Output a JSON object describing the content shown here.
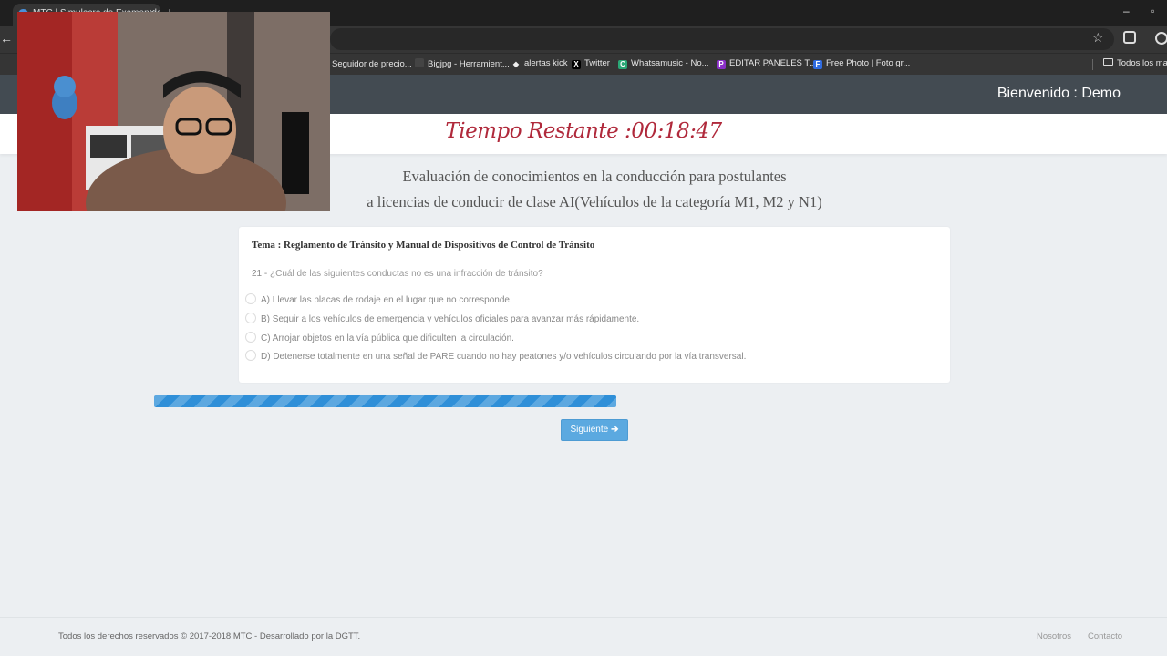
{
  "browser": {
    "tab_title": "MTC | Simulacro de Examen de...",
    "tab_close": "×",
    "new_tab": "+",
    "bookmarks": [
      {
        "label": "Seguidor de precio...",
        "icon": "price-tracker-icon",
        "color": "#2b2b2b",
        "glyph": ""
      },
      {
        "label": "Bigjpg - Herramient...",
        "icon": "bigjpg-icon",
        "color": "#444",
        "glyph": ""
      },
      {
        "label": "alertas kick",
        "icon": "kick-icon",
        "color": "#eee",
        "glyph": "◆"
      },
      {
        "label": "Twitter",
        "icon": "x-twitter-icon",
        "color": "#000",
        "glyph": "X"
      },
      {
        "label": "Whatsamusic - No...",
        "icon": "whatsamusic-icon",
        "color": "#2aa876",
        "glyph": "C"
      },
      {
        "label": "EDITAR PANELES T...",
        "icon": "editar-paneles-icon",
        "color": "#8b2fc9",
        "glyph": "P"
      },
      {
        "label": "Free Photo | Foto gr...",
        "icon": "freepik-icon",
        "color": "#2f6be0",
        "glyph": "F"
      }
    ],
    "all_bookmarks": "Todos los marc"
  },
  "header": {
    "welcome": "Bienvenido : Demo"
  },
  "timer": {
    "label": "Tiempo Restante :",
    "value": "00:18:47"
  },
  "exam": {
    "title_line1": "Evaluación de conocimientos en la conducción para postulantes",
    "title_line2": "a licencias de conducir de clase AI(Vehículos de la categoría M1, M2 y N1)"
  },
  "question": {
    "topic": "Tema : Reglamento de Tránsito y Manual de Dispositivos de Control de Tránsito",
    "number": "21.-",
    "text": "¿Cuál de las siguientes conductas no es una infracción de tránsito?",
    "options": [
      "A) Llevar las placas de rodaje en el lugar que no corresponde.",
      "B) Seguir a los vehículos de emergencia y vehículos oficiales para avanzar más rápidamente.",
      "C) Arrojar objetos en la vía pública que dificulten la circulación.",
      "D) Detenerse totalmente en una señal de PARE cuando no hay peatones y/o vehículos circulando por la vía transversal."
    ]
  },
  "progress": {
    "fraction": 0.4
  },
  "next_button": {
    "label": "Siguiente",
    "arrow": "➔"
  },
  "footer": {
    "copyright": "Todos los derechos reservados © 2017-2018 MTC - Desarrollado por la DGTT.",
    "links": [
      "Nosotros",
      "Contacto"
    ]
  },
  "colors": {
    "header_bg": "#434b52",
    "timer_text": "#b0293b",
    "progress": "#2f8fd8",
    "button": "#5ba9e0"
  }
}
